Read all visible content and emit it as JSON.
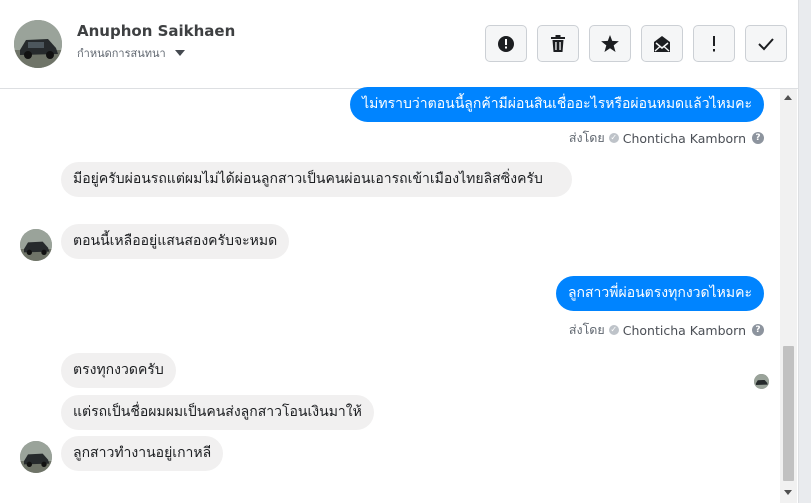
{
  "header": {
    "contact_name": "Anuphon Saikhaen",
    "assign_label": "กำหนดการสนทนา",
    "actions": [
      {
        "name": "report-spam-button",
        "icon": "alert-circle-icon"
      },
      {
        "name": "delete-button",
        "icon": "trash-icon"
      },
      {
        "name": "star-button",
        "icon": "star-icon"
      },
      {
        "name": "mark-unread-button",
        "icon": "envelope-open-icon"
      },
      {
        "name": "follow-up-button",
        "icon": "exclamation-icon"
      },
      {
        "name": "mark-done-button",
        "icon": "checkmark-icon"
      }
    ]
  },
  "messages": {
    "out1": "ไม่ทราบว่าตอนนี้ลูกค้ามีผ่อนสินเชื่ออะไรหรือผ่อนหมดแล้วไหมคะ",
    "in1": "มีอยู่ครับผ่อนรถแต่ผมไม่ได้ผ่อนลูกสาวเป็นคนผ่อนเอารถเข้าเมืองไทยลิสซิ่งครับ",
    "in2": "ตอนนี้เหลืออยู่แสนสองครับจะหมด",
    "out2": "ลูกสาวพี่ผ่อนตรงทุกงวดไหมคะ",
    "in3": "ตรงทุกงวดครับ",
    "in4": "แต่รถเป็นชื่อผมผมเป็นคนส่งลูกสาวโอนเงินมาให้",
    "in5": "ลูกสาวทำงานอยู่เกาหลี"
  },
  "sent_by": {
    "prefix": "ส่งโดย",
    "agent": "Chonticha Kamborn"
  },
  "colors": {
    "outgoing_bubble": "#0084ff",
    "incoming_bubble": "#f1f0f0"
  }
}
